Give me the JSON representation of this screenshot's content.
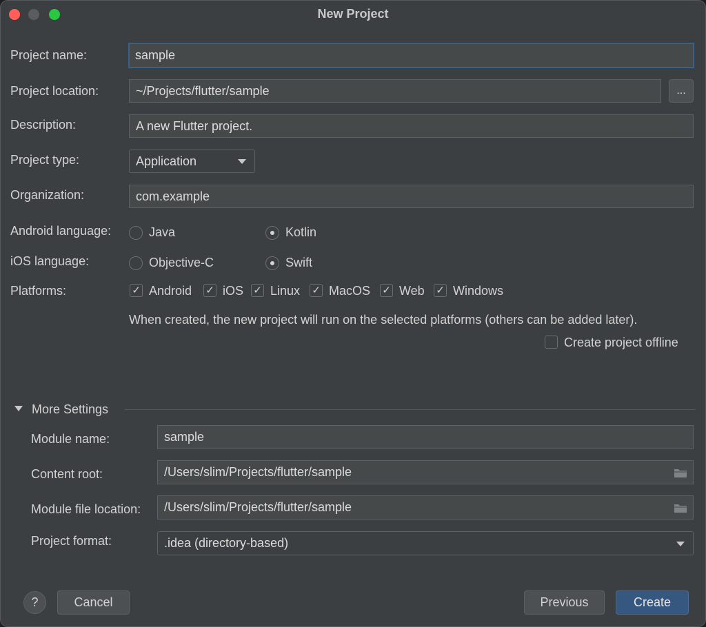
{
  "window": {
    "title": "New Project"
  },
  "form": {
    "project_name": {
      "label": "Project name:",
      "value": "sample"
    },
    "project_location": {
      "label": "Project location:",
      "value": "~/Projects/flutter/sample",
      "browse": "..."
    },
    "description": {
      "label": "Description:",
      "value": "A new Flutter project."
    },
    "project_type": {
      "label": "Project type:",
      "value": "Application"
    },
    "organization": {
      "label": "Organization:",
      "value": "com.example"
    },
    "android_language": {
      "label": "Android language:",
      "options": [
        {
          "label": "Java",
          "checked": false
        },
        {
          "label": "Kotlin",
          "checked": true
        }
      ]
    },
    "ios_language": {
      "label": "iOS language:",
      "options": [
        {
          "label": "Objective-C",
          "checked": false
        },
        {
          "label": "Swift",
          "checked": true
        }
      ]
    },
    "platforms": {
      "label": "Platforms:",
      "options": [
        {
          "label": "Android",
          "checked": true
        },
        {
          "label": "iOS",
          "checked": true
        },
        {
          "label": "Linux",
          "checked": true
        },
        {
          "label": "MacOS",
          "checked": true
        },
        {
          "label": "Web",
          "checked": true
        },
        {
          "label": "Windows",
          "checked": true
        }
      ],
      "note": "When created, the new project will run on the selected platforms (others can be added later)."
    },
    "offline": {
      "label": "Create project offline",
      "checked": false
    }
  },
  "more_settings": {
    "title": "More Settings",
    "expanded": true,
    "module_name": {
      "label": "Module name:",
      "value": "sample"
    },
    "content_root": {
      "label": "Content root:",
      "value": "/Users/slim/Projects/flutter/sample"
    },
    "module_file_location": {
      "label": "Module file location:",
      "value": "/Users/slim/Projects/flutter/sample"
    },
    "project_format": {
      "label": "Project format:",
      "value": ".idea (directory-based)"
    }
  },
  "footer": {
    "help": "?",
    "cancel": "Cancel",
    "previous": "Previous",
    "create": "Create"
  },
  "colors": {
    "background": "#3c3f41",
    "field": "#45494a",
    "focus_border": "#3d6185",
    "primary_button": "#365880"
  }
}
